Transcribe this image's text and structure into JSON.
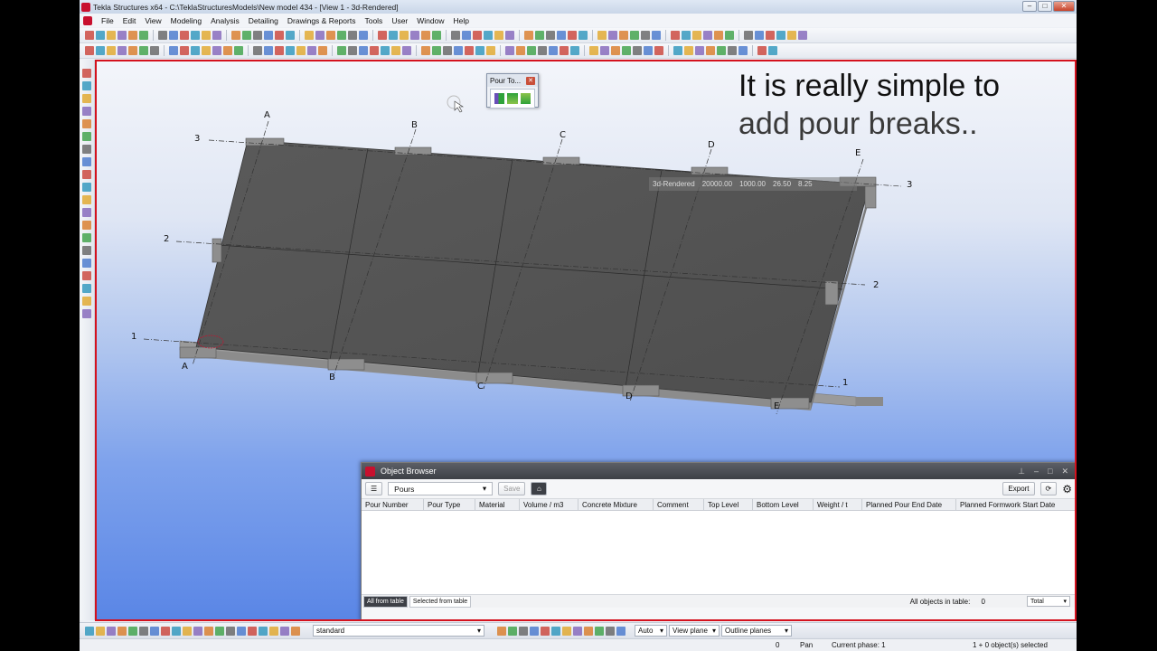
{
  "window": {
    "title": "Tekla Structures x64 - C:\\TeklaStructuresModels\\New model 434 - [View 1 - 3d-Rendered]"
  },
  "menu": [
    "File",
    "Edit",
    "View",
    "Modeling",
    "Analysis",
    "Detailing",
    "Drawings & Reports",
    "Tools",
    "User",
    "Window",
    "Help"
  ],
  "caption": {
    "line1": "It is really simple to",
    "line2": "add pour breaks.."
  },
  "pour_tool": {
    "title": "Pour To..."
  },
  "view_status": {
    "name": "3d-Rendered",
    "v1": "20000.00",
    "v2": "1000.00",
    "v3": "26.50",
    "v4": "8.25"
  },
  "gridlines": {
    "letters": [
      "A",
      "B",
      "C",
      "D",
      "E"
    ],
    "numbers": [
      "1",
      "2",
      "3"
    ]
  },
  "object_browser": {
    "title": "Object Browser",
    "dropdown": "Pours",
    "save": "Save",
    "export": "Export",
    "columns": [
      "Pour Number",
      "Pour Type",
      "Material",
      "Volume / m3",
      "Concrete Mixture",
      "Comment",
      "Top Level",
      "Bottom Level",
      "Weight / t",
      "Planned Pour End Date",
      "Planned Formwork Start Date"
    ],
    "tab_all": "All from table",
    "tab_selected": "Selected from table",
    "count_label": "All objects in table:",
    "count_value": "0",
    "total": "Total"
  },
  "bottom": {
    "standard": "standard",
    "auto": "Auto",
    "view_plane": "View plane",
    "outline_planes": "Outline planes"
  },
  "status": {
    "zero": "0",
    "pan": "Pan",
    "phase": "Current phase: 1",
    "selected": "1 + 0 object(s) selected"
  },
  "colors": {
    "viewport_border": "#d4121e",
    "slab": "#555555",
    "accent": "#c8102e"
  }
}
